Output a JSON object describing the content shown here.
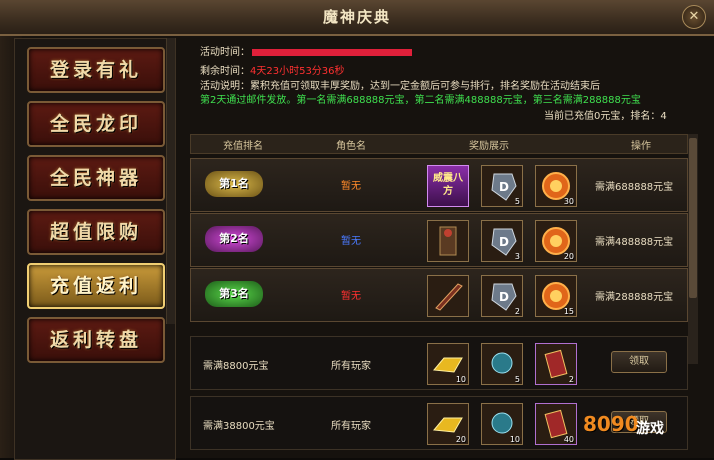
{
  "window": {
    "title": "魔神庆典",
    "close": "✕"
  },
  "sidebar": {
    "items": [
      {
        "label": "登录有礼"
      },
      {
        "label": "全民龙印"
      },
      {
        "label": "全民神器"
      },
      {
        "label": "超值限购"
      },
      {
        "label": "充值返利"
      },
      {
        "label": "返利转盘"
      }
    ],
    "active_index": 4
  },
  "info": {
    "time_label": "活动时间：",
    "remain_label": "剩余时间：",
    "remain_value": "4天23小时53分36秒",
    "desc_label": "活动说明：",
    "desc_1": "累积充值可领取丰厚奖励，达到一定金额后可参与排行，排名奖励在活动结束后",
    "desc_2": "第2天通过邮件发放。第一名需满688888元宝，第二名需满488888元宝，第三名需满288888元宝",
    "status": "当前已充值0元宝，排名：4"
  },
  "table": {
    "headers": [
      "充值排名",
      "角色名",
      "奖励展示",
      "操作"
    ],
    "rank_rows": [
      {
        "medal": "第1名",
        "name": "暂无",
        "item1": "威震八方",
        "counts": [
          "",
          "5",
          "30"
        ],
        "req": "需满688888元宝"
      },
      {
        "medal": "第2名",
        "name": "暂无",
        "counts": [
          "",
          "3",
          "20"
        ],
        "req": "需满488888元宝"
      },
      {
        "medal": "第3名",
        "name": "暂无",
        "counts": [
          "",
          "2",
          "15"
        ],
        "req": "需满288888元宝"
      }
    ],
    "reward_rows": [
      {
        "req": "需满8800元宝",
        "who": "所有玩家",
        "counts": [
          "10",
          "5",
          "2"
        ],
        "button": "领取"
      },
      {
        "req": "需满38800元宝",
        "who": "所有玩家",
        "counts": [
          "20",
          "10",
          "40"
        ],
        "button": "领取"
      }
    ]
  },
  "watermark": {
    "brand": "8090",
    "suffix": "游戏"
  },
  "colors": {
    "accent": "#f1cf73",
    "red": "#ff3030",
    "green": "#3fe04f"
  }
}
